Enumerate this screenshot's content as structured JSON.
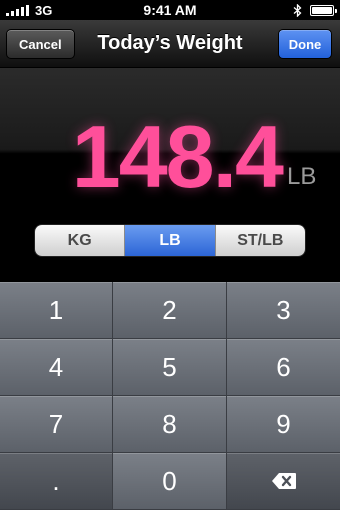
{
  "status_bar": {
    "network": "3G",
    "time": "9:41 AM"
  },
  "nav": {
    "title": "Today’s Weight",
    "cancel_label": "Cancel",
    "done_label": "Done"
  },
  "reading": {
    "value": "148.4",
    "unit": "LB"
  },
  "units": {
    "selected": "LB",
    "options": [
      "KG",
      "LB",
      "ST/LB"
    ]
  },
  "keypad": {
    "keys": [
      "1",
      "2",
      "3",
      "4",
      "5",
      "6",
      "7",
      "8",
      "9",
      ".",
      "0"
    ],
    "delete_icon": "backspace-icon"
  },
  "colors": {
    "value": "#ff4f9a",
    "accent": "#2c65d6"
  }
}
